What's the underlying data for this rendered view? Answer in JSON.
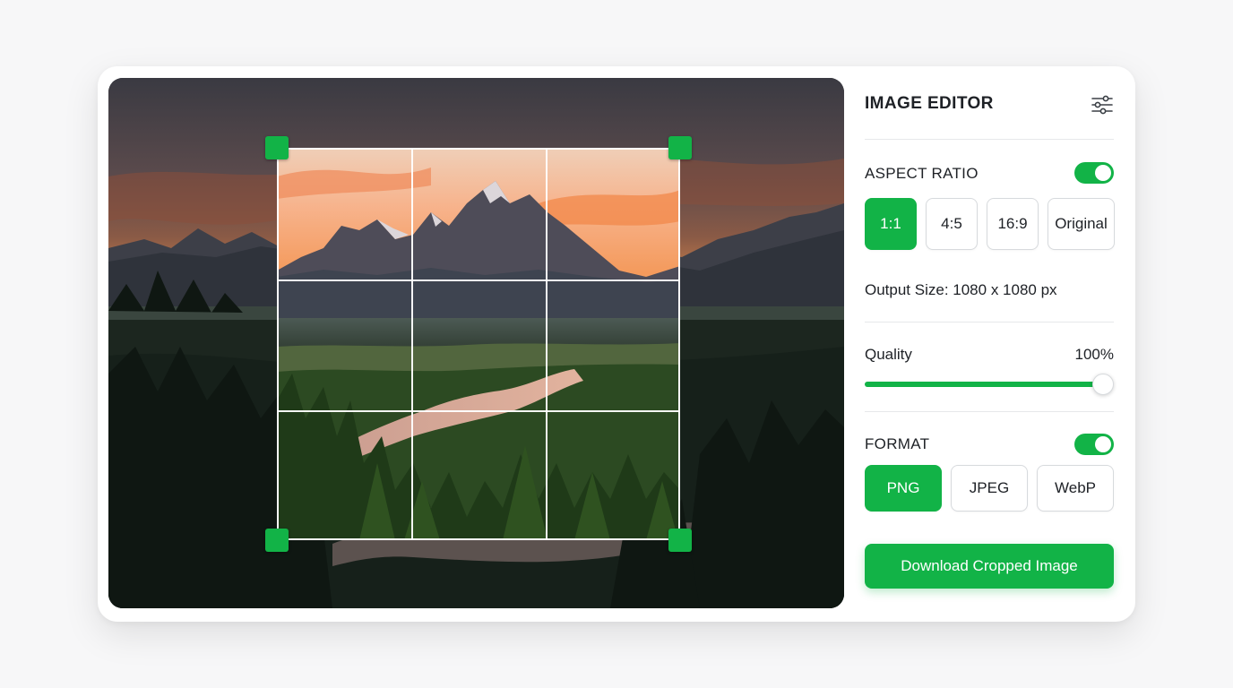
{
  "editor": {
    "title": "IMAGE EDITOR",
    "settings_icon": "sliders-icon",
    "aspect_ratio": {
      "label": "ASPECT RATIO",
      "enabled": true,
      "options": [
        "1:1",
        "4:5",
        "16:9",
        "Original"
      ],
      "selected": "1:1"
    },
    "output_size": "Output Size: 1080 x 1080 px",
    "quality": {
      "label": "Quality",
      "value_text": "100%",
      "value": 1.0
    },
    "format": {
      "label": "FORMAT",
      "enabled": true,
      "options": [
        "PNG",
        "JPEG",
        "WebP"
      ],
      "selected": "PNG"
    },
    "download_label": "Download Cropped Image"
  },
  "colors": {
    "accent": "#12b347",
    "background": "#f7f7f8",
    "card": "#ffffff",
    "text": "#1e2126"
  }
}
